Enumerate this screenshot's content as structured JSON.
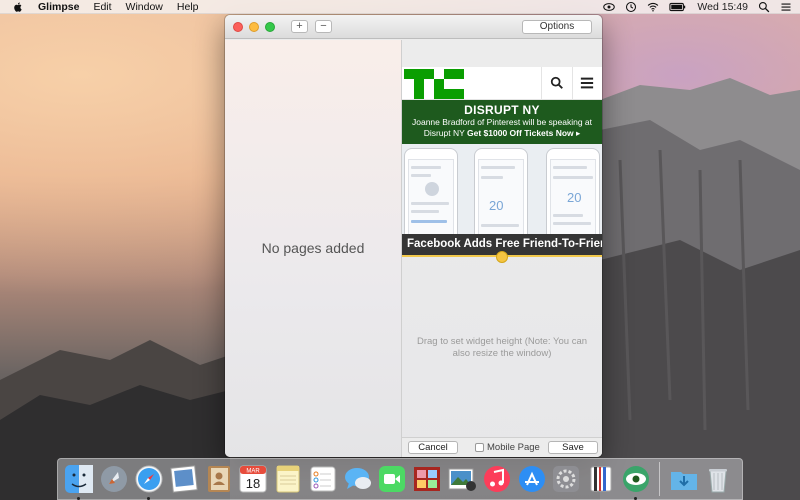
{
  "menubar": {
    "app_name": "Glimpse",
    "items": [
      "Edit",
      "Window",
      "Help"
    ],
    "clock": "Wed 15:49"
  },
  "window": {
    "add_label": "+",
    "remove_label": "−",
    "options_label": "Options",
    "empty_message": "No pages added",
    "drag_hint": "Drag to set widget height (Note: You can also resize the window)",
    "cancel_label": "Cancel",
    "mobile_page_label": "Mobile Page",
    "save_label": "Save"
  },
  "widget": {
    "banner_title": "DISRUPT NY",
    "banner_line": "Joanne Bradford of Pinterest will be speaking at Disrupt NY",
    "banner_cta": "Get $1000 Off Tickets Now ▸",
    "headline": "Facebook Adds Free Friend-To-Friend Payme",
    "phone_value": "20",
    "phone_value_2": "20"
  },
  "dock": {
    "calendar_month": "MAR",
    "calendar_day": "18"
  },
  "colors": {
    "tc_green": "#0a9e01",
    "banner_green": "#1e5a1e",
    "accent_yellow": "#f5c542"
  }
}
